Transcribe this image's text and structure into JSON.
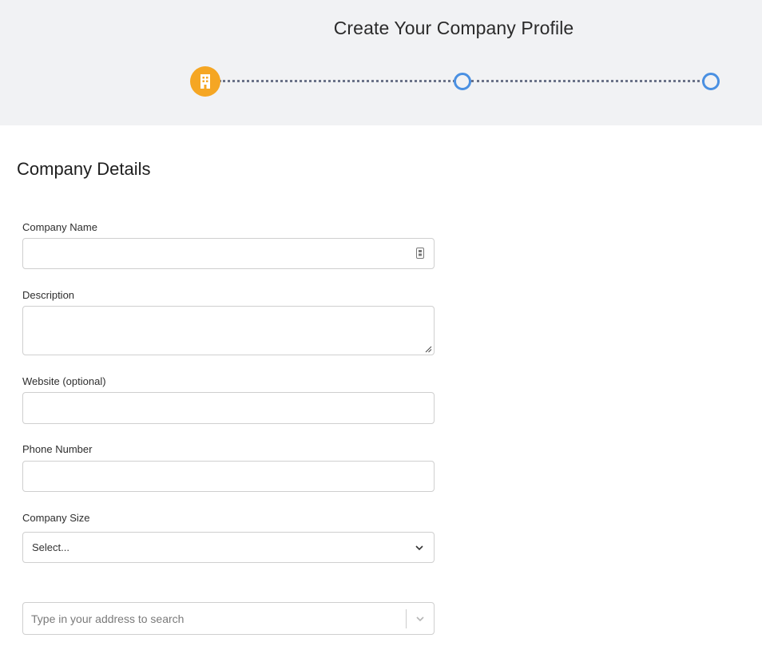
{
  "header": {
    "title": "Create Your Company Profile",
    "steps": [
      {
        "state": "active",
        "icon": "building-icon",
        "color": "#f5a623"
      },
      {
        "state": "upcoming",
        "color": "#4a90e2"
      },
      {
        "state": "upcoming",
        "color": "#4a90e2"
      }
    ]
  },
  "form": {
    "section_title": "Company Details",
    "company_name": {
      "label": "Company Name",
      "value": "",
      "icon": "keypad-icon"
    },
    "description": {
      "label": "Description",
      "value": ""
    },
    "website": {
      "label": "Website (optional)",
      "value": ""
    },
    "phone": {
      "label": "Phone Number",
      "value": ""
    },
    "company_size": {
      "label": "Company Size",
      "selected": "Select..."
    },
    "address": {
      "placeholder": "Type in your address to search"
    }
  }
}
